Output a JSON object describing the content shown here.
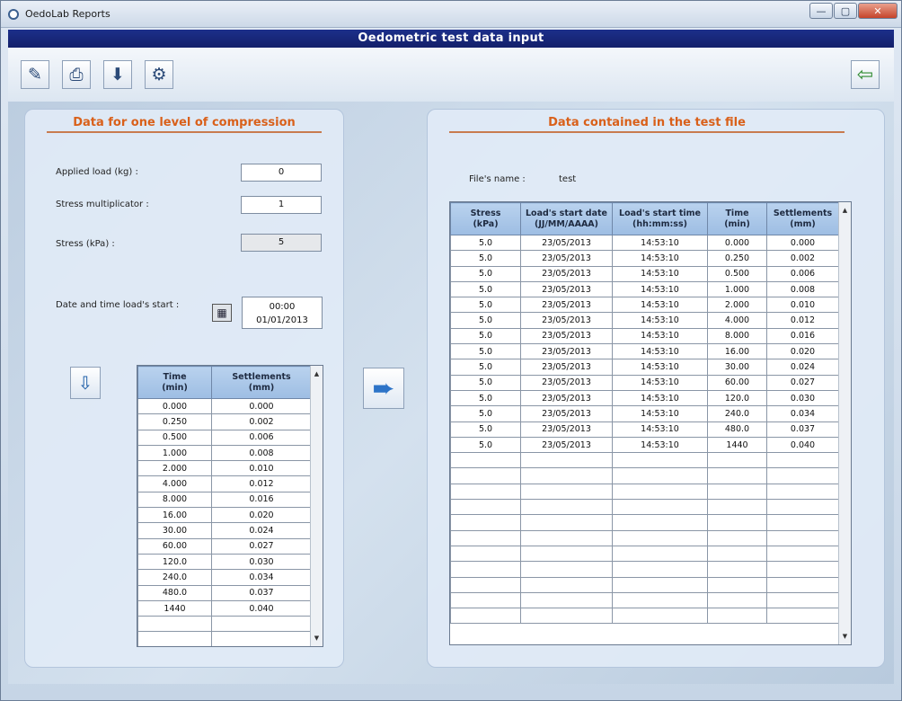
{
  "window": {
    "title": "OedoLab Reports",
    "controls": {
      "minimize": "—",
      "maximize": "▢",
      "close": "✕"
    }
  },
  "header": {
    "title": "Oedometric test data input"
  },
  "toolbar": {
    "icons": [
      "edit-icon",
      "print-icon",
      "save-icon",
      "settings-icon",
      "exit-icon"
    ]
  },
  "left_panel": {
    "title": "Data for one level of compression",
    "applied_load_label": "Applied load (kg) :",
    "applied_load_value": "0",
    "stress_multiplicator_label": "Stress multiplicator :",
    "stress_multiplicator_value": "1",
    "stress_label": "Stress (kPa) :",
    "stress_value": "5",
    "date_label": "Date and time load's start :",
    "date_time": "00:00",
    "date_date": "01/01/2013",
    "grid_headers": [
      [
        "Time",
        "(min)"
      ],
      [
        "Settlements",
        "(mm)"
      ]
    ],
    "rows": [
      [
        "0.000",
        "0.000"
      ],
      [
        "0.250",
        "0.002"
      ],
      [
        "0.500",
        "0.006"
      ],
      [
        "1.000",
        "0.008"
      ],
      [
        "2.000",
        "0.010"
      ],
      [
        "4.000",
        "0.012"
      ],
      [
        "8.000",
        "0.016"
      ],
      [
        "16.00",
        "0.020"
      ],
      [
        "30.00",
        "0.024"
      ],
      [
        "60.00",
        "0.027"
      ],
      [
        "120.0",
        "0.030"
      ],
      [
        "240.0",
        "0.034"
      ],
      [
        "480.0",
        "0.037"
      ],
      [
        "1440",
        "0.040"
      ],
      [
        "",
        ""
      ],
      [
        "",
        ""
      ]
    ]
  },
  "right_panel": {
    "title": "Data contained in the test file",
    "file_label": "File's name :",
    "file_name": "test",
    "grid_headers": [
      [
        "Stress",
        "(kPa)"
      ],
      [
        "Load's start date",
        "(JJ/MM/AAAA)"
      ],
      [
        "Load's start time",
        "(hh:mm:ss)"
      ],
      [
        "Time",
        "(min)"
      ],
      [
        "Settlements",
        "(mm)"
      ]
    ],
    "rows": [
      [
        "5.0",
        "23/05/2013",
        "14:53:10",
        "0.000",
        "0.000"
      ],
      [
        "5.0",
        "23/05/2013",
        "14:53:10",
        "0.250",
        "0.002"
      ],
      [
        "5.0",
        "23/05/2013",
        "14:53:10",
        "0.500",
        "0.006"
      ],
      [
        "5.0",
        "23/05/2013",
        "14:53:10",
        "1.000",
        "0.008"
      ],
      [
        "5.0",
        "23/05/2013",
        "14:53:10",
        "2.000",
        "0.010"
      ],
      [
        "5.0",
        "23/05/2013",
        "14:53:10",
        "4.000",
        "0.012"
      ],
      [
        "5.0",
        "23/05/2013",
        "14:53:10",
        "8.000",
        "0.016"
      ],
      [
        "5.0",
        "23/05/2013",
        "14:53:10",
        "16.00",
        "0.020"
      ],
      [
        "5.0",
        "23/05/2013",
        "14:53:10",
        "30.00",
        "0.024"
      ],
      [
        "5.0",
        "23/05/2013",
        "14:53:10",
        "60.00",
        "0.027"
      ],
      [
        "5.0",
        "23/05/2013",
        "14:53:10",
        "120.0",
        "0.030"
      ],
      [
        "5.0",
        "23/05/2013",
        "14:53:10",
        "240.0",
        "0.034"
      ],
      [
        "5.0",
        "23/05/2013",
        "14:53:10",
        "480.0",
        "0.037"
      ],
      [
        "5.0",
        "23/05/2013",
        "14:53:10",
        "1440",
        "0.040"
      ],
      [
        "",
        "",
        "",
        "",
        ""
      ],
      [
        "",
        "",
        "",
        "",
        ""
      ],
      [
        "",
        "",
        "",
        "",
        ""
      ],
      [
        "",
        "",
        "",
        "",
        ""
      ],
      [
        "",
        "",
        "",
        "",
        ""
      ],
      [
        "",
        "",
        "",
        "",
        ""
      ],
      [
        "",
        "",
        "",
        "",
        ""
      ],
      [
        "",
        "",
        "",
        "",
        ""
      ],
      [
        "",
        "",
        "",
        "",
        ""
      ],
      [
        "",
        "",
        "",
        "",
        ""
      ],
      [
        "",
        "",
        "",
        "",
        ""
      ]
    ]
  },
  "colors": {
    "header": "#1c2f8a",
    "panel_title": "#d9601a",
    "grid_header": "#a9c6ea"
  }
}
